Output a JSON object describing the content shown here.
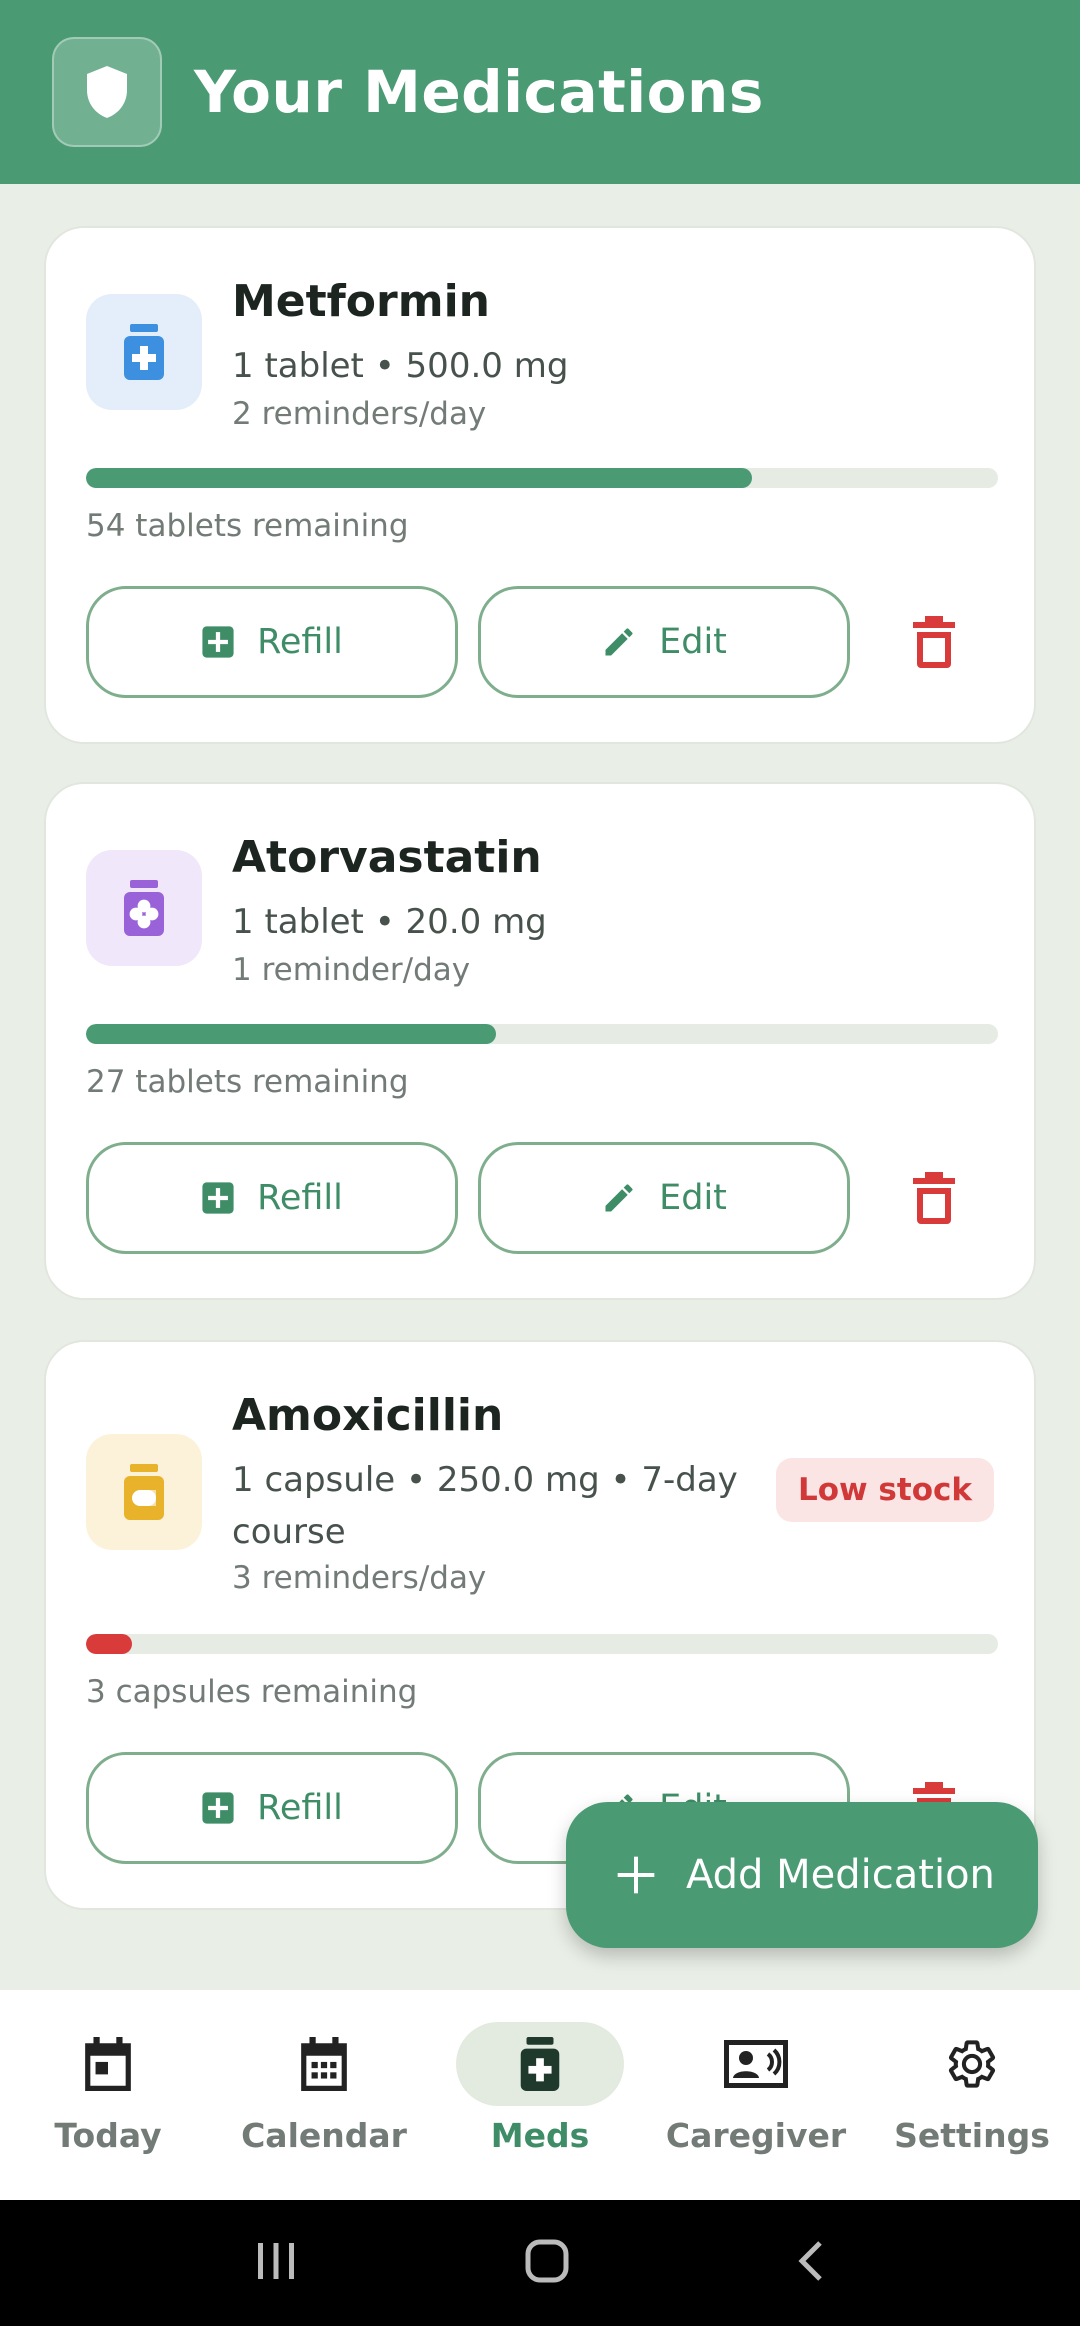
{
  "header": {
    "title": "Your Medications"
  },
  "medications": [
    {
      "name": "Metformin",
      "dose": "1 tablet • 500.0 mg",
      "reminders": "2 reminders/day",
      "remaining": "54 tablets remaining",
      "stock_fraction": 0.73,
      "icon_color": "#3d8fe0",
      "icon_bg": "#e3eefa",
      "refill_label": "Refill",
      "edit_label": "Edit"
    },
    {
      "name": "Atorvastatin",
      "dose": "1 tablet • 20.0 mg",
      "reminders": "1 reminder/day",
      "remaining": "27 tablets remaining",
      "stock_fraction": 0.45,
      "icon_color": "#9a62d8",
      "icon_bg": "#f0e7fa",
      "refill_label": "Refill",
      "edit_label": "Edit"
    },
    {
      "name": "Amoxicillin",
      "dose": "1 capsule • 250.0 mg • 7-day course",
      "reminders": "3 reminders/day",
      "remaining": "3 capsules remaining",
      "stock_fraction": 0.05,
      "badge": "Low stock",
      "icon_color": "#e8b22b",
      "icon_bg": "#fbf2d9",
      "refill_label": "Refill",
      "edit_label": "Edit"
    }
  ],
  "fab": {
    "label": "Add Medication"
  },
  "nav": {
    "items": [
      {
        "label": "Today"
      },
      {
        "label": "Calendar"
      },
      {
        "label": "Meds"
      },
      {
        "label": "Caregiver"
      },
      {
        "label": "Settings"
      }
    ],
    "active": "Meds"
  },
  "colors": {
    "primary": "#4a9a73",
    "danger": "#d93a3a",
    "background": "#e9efe6"
  }
}
